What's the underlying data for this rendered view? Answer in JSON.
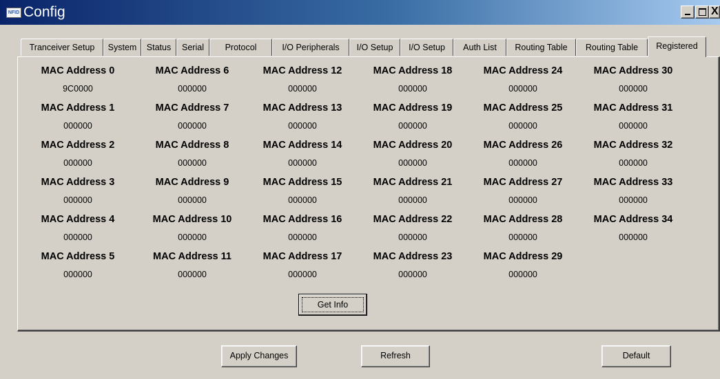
{
  "window": {
    "icon_text": "NFID",
    "title": "Config",
    "close_glyph": "X"
  },
  "tabs": [
    {
      "label": "Tranceiver Setup",
      "active": false
    },
    {
      "label": "System",
      "active": false
    },
    {
      "label": "Status",
      "active": false
    },
    {
      "label": "Serial",
      "active": false
    },
    {
      "label": "Protocol",
      "active": false
    },
    {
      "label": "I/O Peripherals",
      "active": false
    },
    {
      "label": "I/O Setup",
      "active": false
    },
    {
      "label": "I/O Setup",
      "active": false
    },
    {
      "label": "Auth List",
      "active": false
    },
    {
      "label": "Routing Table",
      "active": false
    },
    {
      "label": "Routing Table",
      "active": false
    },
    {
      "label": "Registered",
      "active": true
    }
  ],
  "mac_addresses": [
    {
      "label": "MAC Address 0",
      "value": "9C0000"
    },
    {
      "label": "MAC Address 1",
      "value": "000000"
    },
    {
      "label": "MAC Address 2",
      "value": "000000"
    },
    {
      "label": "MAC Address 3",
      "value": "000000"
    },
    {
      "label": "MAC Address 4",
      "value": "000000"
    },
    {
      "label": "MAC Address 5",
      "value": "000000"
    },
    {
      "label": "MAC Address 6",
      "value": "000000"
    },
    {
      "label": "MAC Address 7",
      "value": "000000"
    },
    {
      "label": "MAC Address 8",
      "value": "000000"
    },
    {
      "label": "MAC Address 9",
      "value": "000000"
    },
    {
      "label": "MAC Address 10",
      "value": "000000"
    },
    {
      "label": "MAC Address 11",
      "value": "000000"
    },
    {
      "label": "MAC Address 12",
      "value": "000000"
    },
    {
      "label": "MAC Address 13",
      "value": "000000"
    },
    {
      "label": "MAC Address 14",
      "value": "000000"
    },
    {
      "label": "MAC Address 15",
      "value": "000000"
    },
    {
      "label": "MAC Address 16",
      "value": "000000"
    },
    {
      "label": "MAC Address 17",
      "value": "000000"
    },
    {
      "label": "MAC Address 18",
      "value": "000000"
    },
    {
      "label": "MAC Address 19",
      "value": "000000"
    },
    {
      "label": "MAC Address 20",
      "value": "000000"
    },
    {
      "label": "MAC Address 21",
      "value": "000000"
    },
    {
      "label": "MAC Address 22",
      "value": "000000"
    },
    {
      "label": "MAC Address 23",
      "value": "000000"
    },
    {
      "label": "MAC Address 24",
      "value": "000000"
    },
    {
      "label": "MAC Address 25",
      "value": "000000"
    },
    {
      "label": "MAC Address 26",
      "value": "000000"
    },
    {
      "label": "MAC Address 27",
      "value": "000000"
    },
    {
      "label": "MAC Address 28",
      "value": "000000"
    },
    {
      "label": "MAC Address 29",
      "value": "000000"
    },
    {
      "label": "MAC Address 30",
      "value": "000000"
    },
    {
      "label": "MAC Address 31",
      "value": "000000"
    },
    {
      "label": "MAC Address 32",
      "value": "000000"
    },
    {
      "label": "MAC Address 33",
      "value": "000000"
    },
    {
      "label": "MAC Address 34",
      "value": "000000"
    }
  ],
  "buttons": {
    "get_info": "Get Info",
    "apply_changes": "Apply Changes",
    "refresh": "Refresh",
    "default": "Default"
  },
  "colors": {
    "title_gradient_start": "#0a246a",
    "title_gradient_end": "#a6caf0",
    "face": "#d4d0c8"
  }
}
